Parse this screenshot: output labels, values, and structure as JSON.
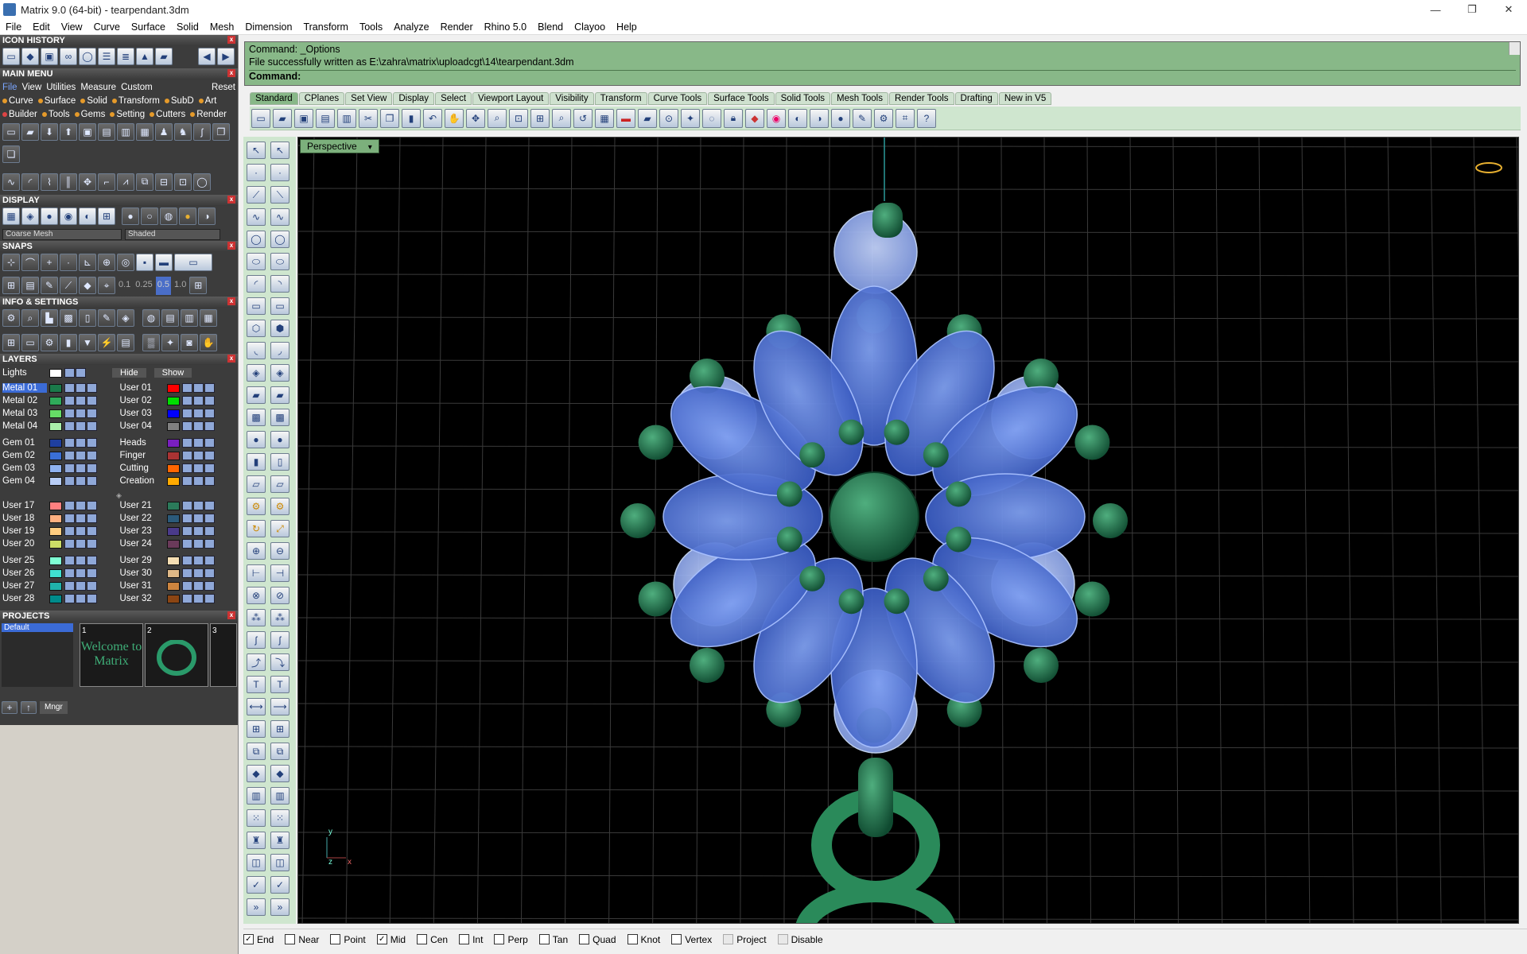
{
  "window": {
    "title": "Matrix 9.0 (64-bit) - tearpendant.3dm",
    "minimize": "—",
    "maximize": "❐",
    "close": "✕"
  },
  "menu": [
    "File",
    "Edit",
    "View",
    "Curve",
    "Surface",
    "Solid",
    "Mesh",
    "Dimension",
    "Transform",
    "Tools",
    "Analyze",
    "Render",
    "Rhino 5.0",
    "Blend",
    "Clayoo",
    "Help"
  ],
  "sections": {
    "icon_history": "ICON HISTORY",
    "main_menu": "MAIN MENU",
    "display": "DISPLAY",
    "snaps": "SNAPS",
    "info_settings": "INFO & SETTINGS",
    "layers": "LAYERS",
    "projects": "PROJECTS"
  },
  "main_menu": {
    "row1": [
      "File",
      "View",
      "Utilities",
      "Measure",
      "Custom",
      "Reset"
    ],
    "row2": [
      "Curve",
      "Surface",
      "Solid",
      "Transform",
      "SubD",
      "Art"
    ],
    "row3": [
      "Builder",
      "Tools",
      "Gems",
      "Setting",
      "Cutters",
      "Render"
    ]
  },
  "display": {
    "mesh": "Coarse Mesh",
    "shade": "Shaded"
  },
  "snaps": {
    "values": [
      "0.1",
      "0.25",
      "0.5",
      "1.0"
    ]
  },
  "layers": {
    "lights": "Lights",
    "hide": "Hide",
    "show": "Show",
    "colors": {
      "metal01": "#1a7a4a",
      "metal02": "#2faa5a",
      "metal03": "#66dd66",
      "metal04": "#aaf0aa",
      "user01": "#ff0000",
      "user02": "#00dd00",
      "user03": "#0000ff",
      "user04": "#808080",
      "gem01": "#1f3f9f",
      "gem02": "#3a6fd6",
      "gem03": "#8fb2f0",
      "gem04": "#b8cdf6",
      "heads": "#7a1fbf",
      "finger": "#aa3333",
      "cutting": "#ff6600",
      "creation": "#ffaa00",
      "user17": "#ff8080",
      "user18": "#ffb080",
      "user19": "#ffcc80",
      "user20": "#ccdd66",
      "user21": "#2b7a5a",
      "user22": "#2b5a7a",
      "user23": "#4a3a8a",
      "user24": "#6a3a5a",
      "user25": "#7fffd4",
      "user26": "#40e0d0",
      "user27": "#20b2aa",
      "user28": "#008b8b",
      "user29": "#f5deb3",
      "user30": "#deb887",
      "user31": "#cd853f",
      "user32": "#8b4513"
    },
    "left": [
      [
        "Metal 01",
        "Metal 02",
        "Metal 03",
        "Metal 04"
      ],
      [
        "Gem 01",
        "Gem 02",
        "Gem 03",
        "Gem 04"
      ],
      [
        "User 17",
        "User 18",
        "User 19",
        "User 20"
      ],
      [
        "User 25",
        "User 26",
        "User 27",
        "User 28"
      ]
    ],
    "right": [
      [
        "User 01",
        "User 02",
        "User 03",
        "User 04"
      ],
      [
        "Heads",
        "Finger",
        "Cutting",
        "Creation"
      ],
      [
        "User 21",
        "User 22",
        "User 23",
        "User 24"
      ],
      [
        "User 29",
        "User 30",
        "User 31",
        "User 32"
      ]
    ]
  },
  "projects": {
    "default": "Default",
    "mngr": "Mngr",
    "thumb1_num": "1",
    "thumb1_text": "Welcome to Matrix",
    "thumb2_num": "2",
    "thumb3_num": "3"
  },
  "command": {
    "line1": "Command: _Options",
    "line2": "File successfully written as E:\\zahra\\matrix\\uploadcgt\\14\\tearpendant.3dm",
    "prompt": "Command:"
  },
  "tabs": [
    "Standard",
    "CPlanes",
    "Set View",
    "Display",
    "Select",
    "Viewport Layout",
    "Visibility",
    "Transform",
    "Curve Tools",
    "Surface Tools",
    "Solid Tools",
    "Mesh Tools",
    "Render Tools",
    "Drafting",
    "New in V5"
  ],
  "active_tab": "Standard",
  "viewport": {
    "label": "Perspective",
    "axis_y": "y",
    "axis_z": "z",
    "axis_x": "x"
  },
  "statusbar": {
    "snaps": [
      {
        "label": "End",
        "checked": true
      },
      {
        "label": "Near",
        "checked": false
      },
      {
        "label": "Point",
        "checked": false
      },
      {
        "label": "Mid",
        "checked": true
      },
      {
        "label": "Cen",
        "checked": false
      },
      {
        "label": "Int",
        "checked": false
      },
      {
        "label": "Perp",
        "checked": false
      },
      {
        "label": "Tan",
        "checked": false
      },
      {
        "label": "Quad",
        "checked": false
      },
      {
        "label": "Knot",
        "checked": false
      },
      {
        "label": "Vertex",
        "checked": false
      },
      {
        "label": "Project",
        "checked": false
      },
      {
        "label": "Disable",
        "checked": false
      }
    ]
  }
}
